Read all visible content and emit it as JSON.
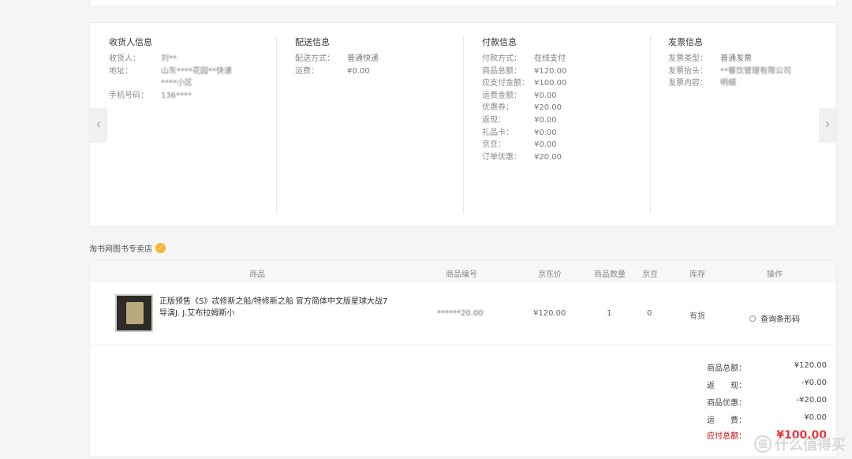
{
  "consignee": {
    "title": "收货人信息",
    "rows": [
      {
        "label": "收货人：",
        "value": "刘**"
      },
      {
        "label": "地址：",
        "value": "山东****花园**快递"
      },
      {
        "label": "",
        "value": "****小区"
      },
      {
        "label": "手机号码：",
        "value": "136****"
      }
    ]
  },
  "delivery": {
    "title": "配送信息",
    "rows": [
      {
        "label": "配送方式：",
        "value": "普通快递"
      },
      {
        "label": "运费：",
        "value": "¥0.00"
      }
    ]
  },
  "payment": {
    "title": "付款信息",
    "rows": [
      {
        "label": "付款方式：",
        "value": "在线支付"
      },
      {
        "label": "商品总额：",
        "value": "¥120.00"
      },
      {
        "label": "应支付金额：",
        "value": "¥100.00"
      },
      {
        "label": "运费金额：",
        "value": "¥0.00"
      },
      {
        "label": "优惠券：",
        "value": "¥20.00"
      },
      {
        "label": "返现：",
        "value": "¥0.00"
      },
      {
        "label": "礼品卡：",
        "value": "¥0.00"
      },
      {
        "label": "京豆：",
        "value": "¥0.00"
      },
      {
        "label": "订单优惠：",
        "value": "¥20.00"
      }
    ]
  },
  "invoice": {
    "title": "发票信息",
    "rows": [
      {
        "label": "发票类型：",
        "value": "普通发票"
      },
      {
        "label": "发票抬头：",
        "value": "**餐饮管理有限公司"
      },
      {
        "label": "发票内容：",
        "value": "明细"
      }
    ]
  },
  "nav": {
    "prev": "‹",
    "next": "›"
  },
  "shop": {
    "name": "淘书网图书专卖店"
  },
  "table": {
    "headers": [
      "商品",
      "商品编号",
      "京东价",
      "商品数量",
      "京豆",
      "库存",
      "操作"
    ],
    "item": {
      "name": "正版预售《S》忒修斯之船/特修斯之船 官方简体中文版星球大战7导演J. J.艾布拉姆斯小",
      "code": "******20.00",
      "price": "¥120.00",
      "qty": "1",
      "beans": "0",
      "stock": "有货",
      "action": "查询条形码"
    }
  },
  "summary": {
    "rows": [
      {
        "label": "商品总额：",
        "value": "¥120.00"
      },
      {
        "label": "返　　现：",
        "value": "-¥0.00"
      },
      {
        "label": "商品优惠：",
        "value": "-¥20.00"
      },
      {
        "label": "运　　费：",
        "value": "¥0.00"
      }
    ],
    "total_label": "应付总额：",
    "total_value": "¥100.00"
  },
  "watermark": {
    "text": "什么值得买",
    "logo": "值"
  }
}
